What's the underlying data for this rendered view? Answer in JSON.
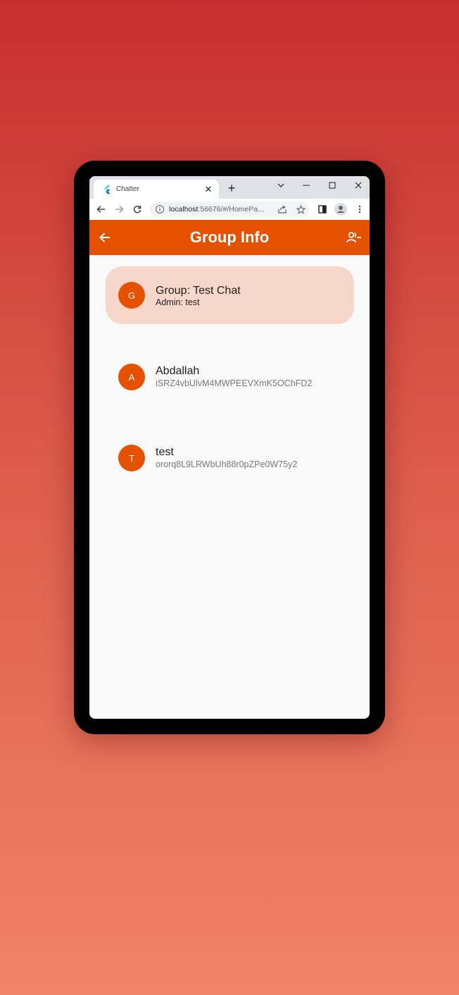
{
  "browser": {
    "tab_title": "Chatter",
    "tab_close": "✕",
    "new_tab": "+",
    "url_host": "localhost",
    "url_rest": ":56676/#/HomePa..."
  },
  "appbar": {
    "title": "Group Info"
  },
  "group": {
    "avatar_letter": "G",
    "title": "Group: Test Chat",
    "admin": "Admin: test"
  },
  "members": [
    {
      "avatar_letter": "A",
      "name": "Abdallah",
      "uid": "iSRZ4vbUlvM4MWPEEVXmK5OChFD2"
    },
    {
      "avatar_letter": "T",
      "name": "test",
      "uid": "ororq8L9LRWbUh88r0pZPe0W75y2"
    }
  ],
  "colors": {
    "accent": "#e65100",
    "group_card": "#f6d7c9",
    "background": "#f9f9f9"
  },
  "icons": [
    "flutter-icon",
    "close-icon",
    "plus-icon",
    "chevron-down-icon",
    "minimize-icon",
    "maximize-icon",
    "window-close-icon",
    "back-arrow-icon",
    "forward-arrow-icon",
    "reload-icon",
    "info-icon",
    "share-icon",
    "star-icon",
    "sidepanel-icon",
    "profile-icon",
    "more-vert-icon",
    "arrow-back-icon",
    "person-remove-icon"
  ]
}
